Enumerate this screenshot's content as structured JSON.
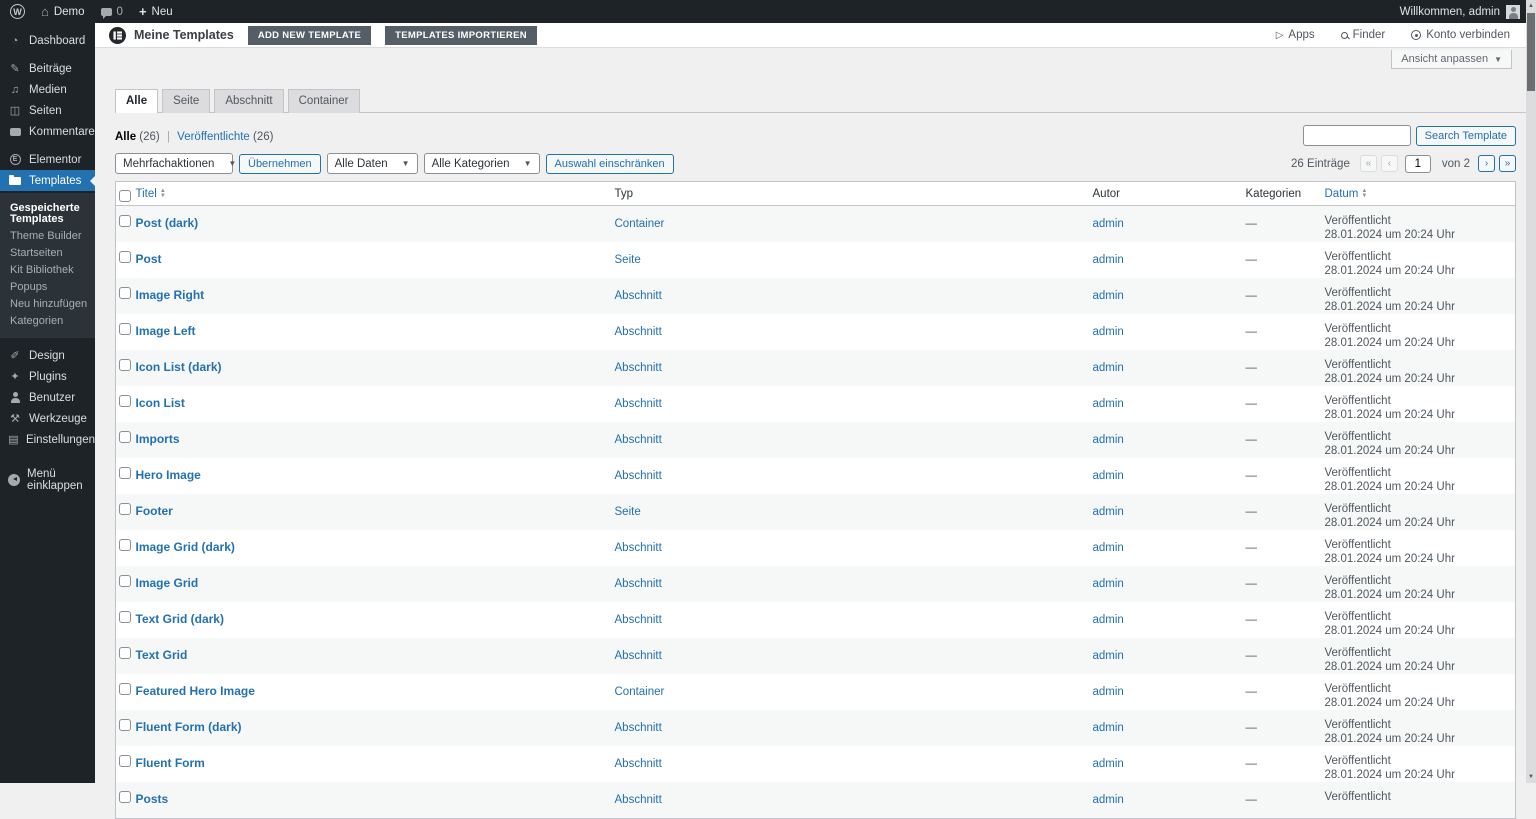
{
  "admin_bar": {
    "site_name": "Demo",
    "comments_count": "0",
    "new_label": "Neu",
    "welcome": "Willkommen, admin"
  },
  "sidebar": {
    "groups": [
      {
        "items": [
          {
            "label": "Dashboard",
            "icon": "dashboard-icon",
            "glyph": "◔"
          }
        ]
      },
      {
        "items": [
          {
            "label": "Beiträge",
            "icon": "posts-icon",
            "glyph": "✎"
          },
          {
            "label": "Medien",
            "icon": "media-icon",
            "glyph": "♫"
          },
          {
            "label": "Seiten",
            "icon": "pages-icon",
            "glyph": "◫"
          },
          {
            "label": "Kommentare",
            "icon": "comments-icon",
            "shape": "bubble"
          }
        ]
      },
      {
        "items": [
          {
            "label": "Elementor",
            "icon": "elementor-icon",
            "shape": "circle-e",
            "glyph": "E"
          },
          {
            "label": "Templates",
            "icon": "templates-icon",
            "shape": "folder",
            "active": true
          }
        ]
      }
    ],
    "templates_submenu": [
      {
        "label": "Gespeicherte Templates",
        "current": true
      },
      {
        "label": "Theme Builder"
      },
      {
        "label": "Startseiten"
      },
      {
        "label": "Kit Bibliothek"
      },
      {
        "label": "Popups"
      },
      {
        "label": "Neu hinzufügen"
      },
      {
        "label": "Kategorien"
      }
    ],
    "lower_group": {
      "items": [
        {
          "label": "Design",
          "icon": "design-icon",
          "glyph": "✐"
        },
        {
          "label": "Plugins",
          "icon": "plugins-icon",
          "glyph": "✦"
        },
        {
          "label": "Benutzer",
          "icon": "users-icon",
          "shape": "person"
        },
        {
          "label": "Werkzeuge",
          "icon": "tools-icon",
          "glyph": "⚒"
        },
        {
          "label": "Einstellungen",
          "icon": "settings-icon",
          "glyph": "▤"
        }
      ]
    },
    "collapse": {
      "label": "Menü einklappen",
      "icon": "collapse-icon",
      "shape": "collapse"
    }
  },
  "header": {
    "title": "Meine Templates",
    "add_new_label": "ADD NEW TEMPLATE",
    "import_label": "TEMPLATES IMPORTIEREN",
    "apps_label": "Apps",
    "finder_label": "Finder",
    "connect_label": "Konto verbinden"
  },
  "screen_options": {
    "label": "Ansicht anpassen"
  },
  "tabs": [
    {
      "label": "Alle",
      "active": true
    },
    {
      "label": "Seite"
    },
    {
      "label": "Abschnitt"
    },
    {
      "label": "Container"
    }
  ],
  "filters": {
    "all_label": "Alle",
    "all_count": "(26)",
    "separator": "|",
    "published_label": "Veröffentlichte",
    "published_count": "(26)",
    "search_button": "Search Template"
  },
  "toolbar": {
    "bulk_select": "Mehrfachaktionen",
    "apply_button": "Übernehmen",
    "dates_select": "Alle Daten",
    "categories_select": "Alle Kategorien",
    "filter_button": "Auswahl einschränken"
  },
  "pagination": {
    "items_count": "26 Einträge",
    "first": "«",
    "prev": "‹",
    "current_page": "1",
    "of_label": "von 2",
    "next": "›",
    "last": "»"
  },
  "table": {
    "headers": {
      "title": "Titel",
      "type": "Typ",
      "author": "Autor",
      "categories": "Kategorien",
      "date": "Datum"
    },
    "status_label": "Veröffentlicht",
    "empty_categories": "—",
    "rows": [
      {
        "title": "Post (dark)",
        "type": "Container",
        "author": "admin",
        "categories": "—",
        "status": "Veröffentlicht",
        "date": "28.01.2024 um 20:24 Uhr"
      },
      {
        "title": "Post",
        "type": "Seite",
        "author": "admin",
        "categories": "—",
        "status": "Veröffentlicht",
        "date": "28.01.2024 um 20:24 Uhr"
      },
      {
        "title": "Image Right",
        "type": "Abschnitt",
        "author": "admin",
        "categories": "—",
        "status": "Veröffentlicht",
        "date": "28.01.2024 um 20:24 Uhr"
      },
      {
        "title": "Image Left",
        "type": "Abschnitt",
        "author": "admin",
        "categories": "—",
        "status": "Veröffentlicht",
        "date": "28.01.2024 um 20:24 Uhr"
      },
      {
        "title": "Icon List (dark)",
        "type": "Abschnitt",
        "author": "admin",
        "categories": "—",
        "status": "Veröffentlicht",
        "date": "28.01.2024 um 20:24 Uhr"
      },
      {
        "title": "Icon List",
        "type": "Abschnitt",
        "author": "admin",
        "categories": "—",
        "status": "Veröffentlicht",
        "date": "28.01.2024 um 20:24 Uhr"
      },
      {
        "title": "Imports",
        "type": "Abschnitt",
        "author": "admin",
        "categories": "—",
        "status": "Veröffentlicht",
        "date": "28.01.2024 um 20:24 Uhr"
      },
      {
        "title": "Hero Image",
        "type": "Abschnitt",
        "author": "admin",
        "categories": "—",
        "status": "Veröffentlicht",
        "date": "28.01.2024 um 20:24 Uhr"
      },
      {
        "title": "Footer",
        "type": "Seite",
        "author": "admin",
        "categories": "—",
        "status": "Veröffentlicht",
        "date": "28.01.2024 um 20:24 Uhr"
      },
      {
        "title": "Image Grid (dark)",
        "type": "Abschnitt",
        "author": "admin",
        "categories": "—",
        "status": "Veröffentlicht",
        "date": "28.01.2024 um 20:24 Uhr"
      },
      {
        "title": "Image Grid",
        "type": "Abschnitt",
        "author": "admin",
        "categories": "—",
        "status": "Veröffentlicht",
        "date": "28.01.2024 um 20:24 Uhr"
      },
      {
        "title": "Text Grid (dark)",
        "type": "Abschnitt",
        "author": "admin",
        "categories": "—",
        "status": "Veröffentlicht",
        "date": "28.01.2024 um 20:24 Uhr"
      },
      {
        "title": "Text Grid",
        "type": "Abschnitt",
        "author": "admin",
        "categories": "—",
        "status": "Veröffentlicht",
        "date": "28.01.2024 um 20:24 Uhr"
      },
      {
        "title": "Featured Hero Image",
        "type": "Container",
        "author": "admin",
        "categories": "—",
        "status": "Veröffentlicht",
        "date": "28.01.2024 um 20:24 Uhr"
      },
      {
        "title": "Fluent Form (dark)",
        "type": "Abschnitt",
        "author": "admin",
        "categories": "—",
        "status": "Veröffentlicht",
        "date": "28.01.2024 um 20:24 Uhr"
      },
      {
        "title": "Fluent Form",
        "type": "Abschnitt",
        "author": "admin",
        "categories": "—",
        "status": "Veröffentlicht",
        "date": "28.01.2024 um 20:24 Uhr"
      },
      {
        "title": "Posts",
        "type": "Abschnitt",
        "author": "admin",
        "categories": "—",
        "status": "Veröffentlicht",
        "date": ""
      }
    ]
  },
  "colors": {
    "accent": "#2271b1",
    "admin_dark": "#1d2327",
    "page_bg": "#f0f0f1"
  }
}
